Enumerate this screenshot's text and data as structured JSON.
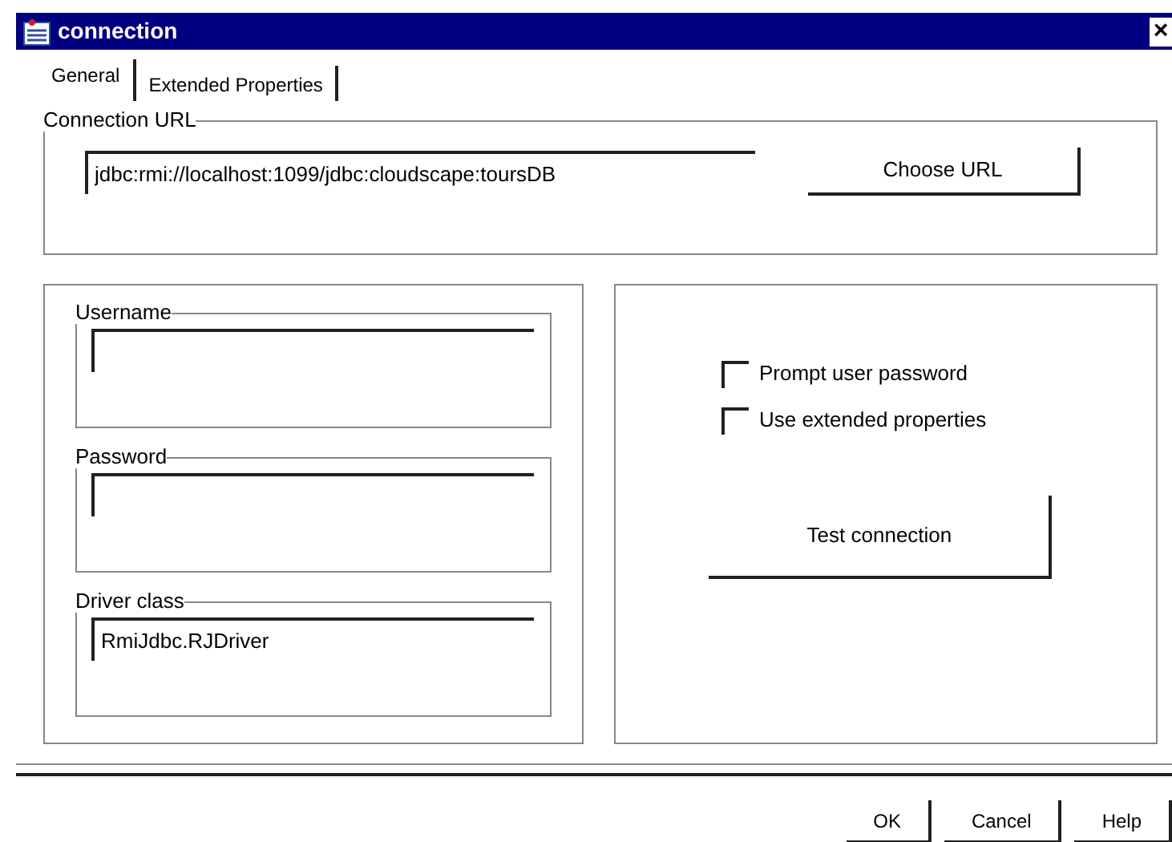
{
  "window": {
    "title": "connection",
    "close": "×"
  },
  "tabs": [
    {
      "label": "General",
      "selected": true
    },
    {
      "label": "Extended Properties",
      "selected": false
    }
  ],
  "connection_url": {
    "legend": "Connection URL",
    "value": "jdbc:rmi://localhost:1099/jdbc:cloudscape:toursDB",
    "button": "Choose URL"
  },
  "fields": [
    {
      "legend": "Username"
    },
    {
      "legend": "Password"
    },
    {
      "legend": "Driver class",
      "value": "RmiJdbc.RJDriver"
    }
  ],
  "options": [
    {
      "label": "Prompt user password",
      "checked": false
    },
    {
      "label": "Use extended properties",
      "checked": false
    }
  ],
  "test_button": "Test connection",
  "buttons": [
    "OK",
    "Cancel",
    "Help"
  ]
}
